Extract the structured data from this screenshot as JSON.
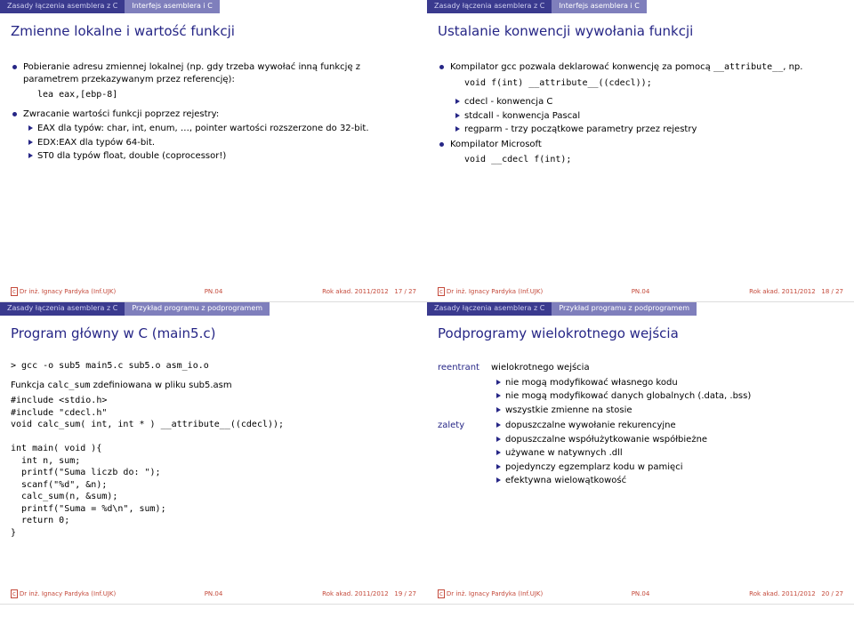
{
  "nav": {
    "section": "Zasady łączenia asemblera z C",
    "sub_interface": "Interfejs asemblera i C",
    "sub_example": "Przykład programu z podprogramem"
  },
  "slide17": {
    "title": "Zmienne lokalne i wartość funkcji",
    "b1": "Pobieranie adresu zmiennej lokalnej (np. gdy trzeba wywołać inną funkcję z parametrem przekazywanym przez referencję):",
    "code1": "lea eax,[ebp-8]",
    "b2": "Zwracanie wartości funkcji poprzez rejestry:",
    "s1": "EAX dla typów: char, int, enum, …, pointer wartości rozszerzone do 32-bit.",
    "s2": "EDX:EAX dla typów 64-bit.",
    "s3": "ST0 dla typów float, double (coprocessor!)",
    "pagelabel": "17 / 27"
  },
  "slide18": {
    "title": "Ustalanie konwencji wywołania funkcji",
    "b1a": "Kompilator gcc pozwala deklarować konwencję za pomocą ",
    "b1code": "__attribute__",
    "b1b": ", np.",
    "code1": "void f(int) __attribute__((cdecl));",
    "s1": "cdecl - konwencja C",
    "s2": "stdcall - konwencja Pascal",
    "s3": "regparm - trzy początkowe parametry przez rejestry",
    "b3": "Kompilator Microsoft",
    "code2": "void __cdecl f(int);",
    "pagelabel": "18 / 27"
  },
  "slide19": {
    "title": "Program główny w C (main5.c)",
    "cmd": "> gcc -o sub5 main5.c sub5.o asm_io.o",
    "desc_a": "Funkcja ",
    "desc_code": "calc_sum",
    "desc_b": " zdefiniowana w pliku sub5.asm",
    "code": "#include <stdio.h>\n#include \"cdecl.h\"\nvoid calc_sum( int, int * ) __attribute__((cdecl));\n\nint main( void ){\n  int n, sum;\n  printf(\"Suma liczb do: \");\n  scanf(\"%d\", &n);\n  calc_sum(n, &sum);\n  printf(\"Suma = %d\\n\", sum);\n  return 0;\n}",
    "pagelabel": "19 / 27"
  },
  "slide20": {
    "title": "Podprogramy wielokrotnego wejścia",
    "dt1": "reentrant",
    "dd1": "wielokrotnego wejścia",
    "r1": "nie mogą modyfikować własnego kodu",
    "r2": "nie mogą modyfikować danych globalnych (.data, .bss)",
    "r3": "wszystkie zmienne na stosie",
    "dt2": "zalety",
    "z1": "dopuszczalne wywołanie rekurencyjne",
    "z2": "dopuszczalne współużytkowanie współbieżne",
    "z3": "używane w natywnych .dll",
    "z4": "pojedynczy egzemplarz kodu w pamięci",
    "z5": "efektywna wielowątkowość",
    "pagelabel": "20 / 27"
  },
  "footer": {
    "author": "Dr inż. Ignacy Pardyka (Inf.UJK)",
    "mid": "PN.04",
    "term": "Rok akad. 2011/2012"
  }
}
